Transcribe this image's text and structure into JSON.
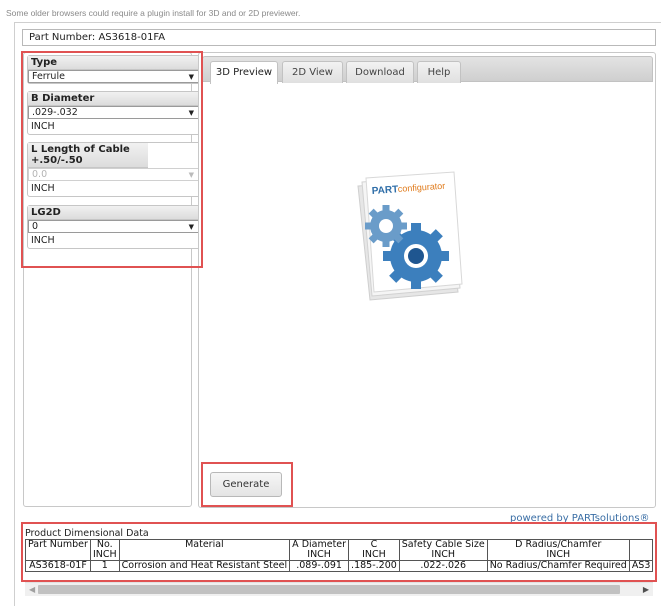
{
  "notice": "Some older browsers could require a plugin install for 3D and or 2D previewer.",
  "part_number_label": "Part Number: AS3618-01FA",
  "parameters": [
    {
      "label": "Type",
      "value": "Ferrule",
      "unit": "",
      "disabled": false
    },
    {
      "label": "B Diameter",
      "value": ".029-.032",
      "unit": "INCH",
      "disabled": false
    },
    {
      "label": "L Length of Cable +.50/-.50",
      "value": "0.0",
      "unit": "INCH",
      "disabled": true
    },
    {
      "label": "LG2D",
      "value": "0",
      "unit": "INCH",
      "disabled": false
    }
  ],
  "tabs": [
    "3D Preview",
    "2D View",
    "Download",
    "Help"
  ],
  "active_tab": "3D Preview",
  "logo_text": {
    "prefix": "PART",
    "suffix": "configurator"
  },
  "generate_label": "Generate",
  "powered_by": "powered by PARTsolutions®",
  "table": {
    "title": "Product Dimensional Data",
    "headers": [
      {
        "name": "Part Number",
        "unit": ""
      },
      {
        "name": "No.",
        "unit": "INCH"
      },
      {
        "name": "Material",
        "unit": ""
      },
      {
        "name": "A Diameter",
        "unit": "INCH"
      },
      {
        "name": "C",
        "unit": "INCH"
      },
      {
        "name": "Safety Cable Size",
        "unit": "INCH"
      },
      {
        "name": "D Radius/Chamfer",
        "unit": "INCH"
      },
      {
        "name": "",
        "unit": ""
      }
    ],
    "row": [
      "AS3618-01F",
      "1",
      "Corrosion and Heat Resistant Steel",
      ".089-.091",
      ".185-.200",
      ".022-.026",
      "No Radius/Chamfer Required",
      "AS3"
    ]
  },
  "colors": {
    "highlight": "#e05252",
    "link": "#3a6ea5",
    "logo_blue": "#2f6ea8"
  }
}
